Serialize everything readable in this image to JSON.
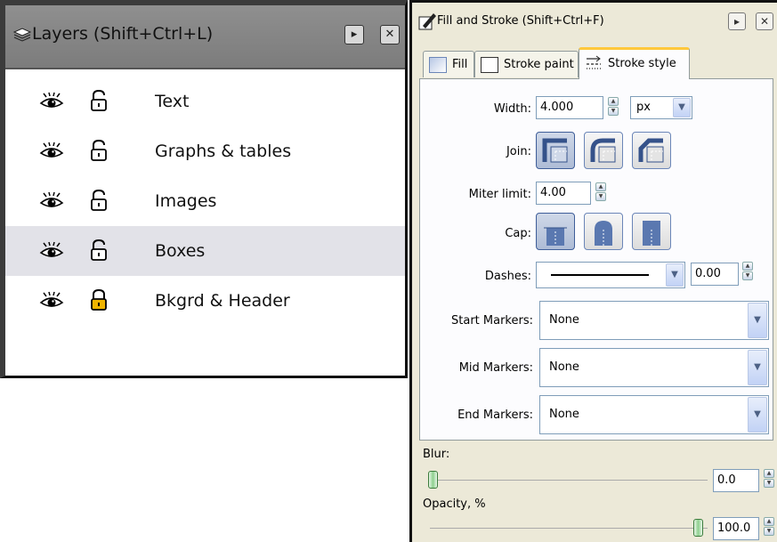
{
  "layers": {
    "title": "Layers (Shift+Ctrl+L)",
    "rows": [
      {
        "name": "Text",
        "visible": true,
        "locked": false,
        "selected": false
      },
      {
        "name": "Graphs & tables",
        "visible": true,
        "locked": false,
        "selected": false
      },
      {
        "name": "Images",
        "visible": true,
        "locked": false,
        "selected": false
      },
      {
        "name": "Boxes",
        "visible": true,
        "locked": false,
        "selected": true
      },
      {
        "name": "Bkgrd & Header",
        "visible": true,
        "locked": true,
        "selected": false
      }
    ]
  },
  "fill_stroke": {
    "title": "Fill and Stroke (Shift+Ctrl+F)",
    "tabs": [
      {
        "label": "Fill",
        "icon": "fill-swatch-icon"
      },
      {
        "label": "Stroke paint",
        "icon": "stroke-paint-icon"
      },
      {
        "label": "Stroke style",
        "icon": "stroke-style-icon",
        "active": true
      }
    ],
    "width": {
      "label": "Width:",
      "value": "4.000",
      "unit": "px"
    },
    "join": {
      "label": "Join:",
      "options": [
        "miter-join",
        "round-join",
        "bevel-join"
      ],
      "selected": "miter-join"
    },
    "miter": {
      "label": "Miter limit:",
      "value": "4.00"
    },
    "cap": {
      "label": "Cap:",
      "options": [
        "butt-cap",
        "round-cap",
        "square-cap"
      ],
      "selected": "butt-cap"
    },
    "dashes": {
      "label": "Dashes:",
      "offset": "0.00"
    },
    "start_markers": {
      "label": "Start Markers:",
      "value": "None"
    },
    "mid_markers": {
      "label": "Mid Markers:",
      "value": "None"
    },
    "end_markers": {
      "label": "End Markers:",
      "value": "None"
    },
    "blur": {
      "label": "Blur:",
      "value": "0.0",
      "level": 0.0
    },
    "opacity": {
      "label": "Opacity, %",
      "value": "100.0",
      "level": 1.0
    }
  },
  "colors": {
    "layers_header": "#8a8a8a",
    "selected_row": "#e2e2e8",
    "panel_bg": "#ece9d8",
    "active_tab_accent": "#ffc83c",
    "lock_closed": "#f0b400"
  }
}
